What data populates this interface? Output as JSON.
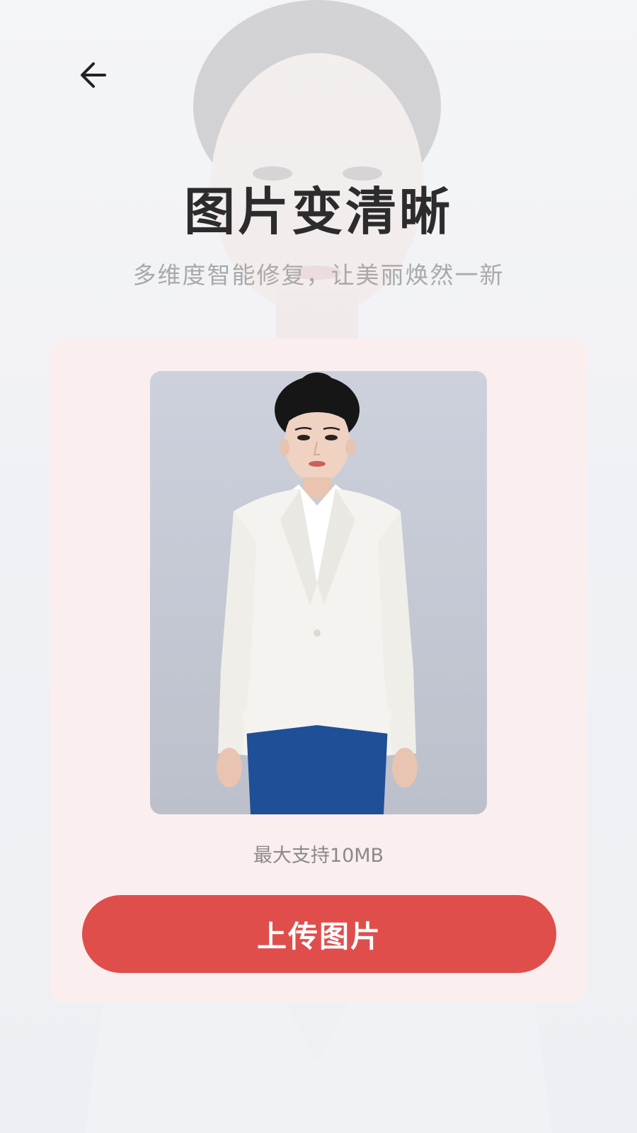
{
  "header": {
    "back_icon": "arrow-left-icon"
  },
  "hero": {
    "title": "图片变清晰",
    "subtitle": "多维度智能修复，让美丽焕然一新"
  },
  "upload_card": {
    "sample_image": "sample-portrait",
    "size_hint": "最大支持10MB",
    "upload_label": "上传图片"
  },
  "colors": {
    "accent": "#e04e4c",
    "card_background": "#fbeeee",
    "title_text": "#2c2c2c",
    "subtitle_text": "#a9a9a9"
  }
}
